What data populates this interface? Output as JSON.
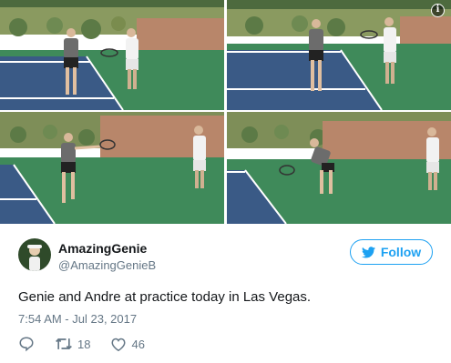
{
  "photos": [
    {
      "icon": "tennis-practice-photo",
      "alt": ""
    },
    {
      "icon": "tennis-practice-photo",
      "alt": ""
    },
    {
      "icon": "tennis-practice-photo",
      "alt": ""
    },
    {
      "icon": "tennis-practice-photo",
      "alt": ""
    }
  ],
  "info_badge": "i",
  "tweet": {
    "display_name": "AmazingGenie",
    "handle": "@AmazingGenieB",
    "follow_label": "Follow",
    "text": "Genie and Andre at practice today in Las Vegas.",
    "timestamp": "7:54 AM - Jul 23, 2017",
    "retweets": "18",
    "likes": "46"
  },
  "icons": {
    "follow": "twitter-bird-icon",
    "reply": "reply-icon",
    "retweet": "retweet-icon",
    "like": "heart-icon"
  },
  "colors": {
    "accent": "#1da1f2",
    "secondary_text": "#657786",
    "court_blue": "#3a5a86",
    "court_green": "#3f8a5a",
    "wall": "#b8866a"
  }
}
